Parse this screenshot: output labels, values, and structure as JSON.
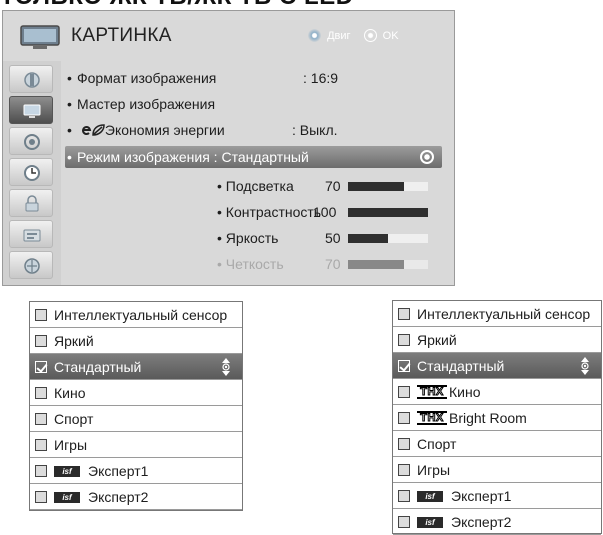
{
  "page_heading": "ТОЛЬКО ЖК ТВ/ЖК ТВ С LED",
  "menu": {
    "title": "КАРТИНКА",
    "hints": {
      "move_label": "Двиг",
      "ok_label": "OK"
    },
    "side_icons": [
      "setup-icon",
      "picture-icon",
      "audio-icon",
      "time-icon",
      "lock-icon",
      "option-icon",
      "network-icon"
    ],
    "options": [
      {
        "label": "Формат изображения",
        "value": ": 16:9"
      },
      {
        "label": "Мастер изображения",
        "value": ""
      },
      {
        "label": "Экономия энергии",
        "value": ": Выкл.",
        "icon": "e-leaf-icon"
      },
      {
        "label": "Режим изображения : Стандартный",
        "value": ""
      }
    ],
    "sliders": [
      {
        "label": "• Подсветка",
        "value": "70",
        "level": 70
      },
      {
        "label": "• Контрастность",
        "value": "100",
        "level": 100
      },
      {
        "label": "• Яркость",
        "value": "50",
        "level": 50
      },
      {
        "label": "• Четкость",
        "value": "70",
        "level": 70
      }
    ]
  },
  "dropdown_left": {
    "items": [
      {
        "label": "Интеллектуальный сенсор",
        "checked": false
      },
      {
        "label": "Яркий",
        "checked": false
      },
      {
        "label": "Стандартный",
        "checked": true
      },
      {
        "label": "Кино",
        "checked": false
      },
      {
        "label": "Спорт",
        "checked": false
      },
      {
        "label": "Игры",
        "checked": false
      },
      {
        "label": "Эксперт1",
        "checked": false,
        "badge": "isf"
      },
      {
        "label": "Эксперт2",
        "checked": false,
        "badge": "isf"
      }
    ]
  },
  "dropdown_right": {
    "items": [
      {
        "label": "Интеллектуальный сенсор",
        "checked": false
      },
      {
        "label": "Яркий",
        "checked": false
      },
      {
        "label": "Стандартный",
        "checked": true
      },
      {
        "label": "Кино",
        "checked": false,
        "badge": "THX"
      },
      {
        "label": "Bright Room",
        "checked": false,
        "badge": "THX"
      },
      {
        "label": "Спорт",
        "checked": false
      },
      {
        "label": "Игры",
        "checked": false
      },
      {
        "label": "Эксперт1",
        "checked": false,
        "badge": "isf"
      },
      {
        "label": "Эксперт2",
        "checked": false,
        "badge": "isf"
      }
    ]
  }
}
